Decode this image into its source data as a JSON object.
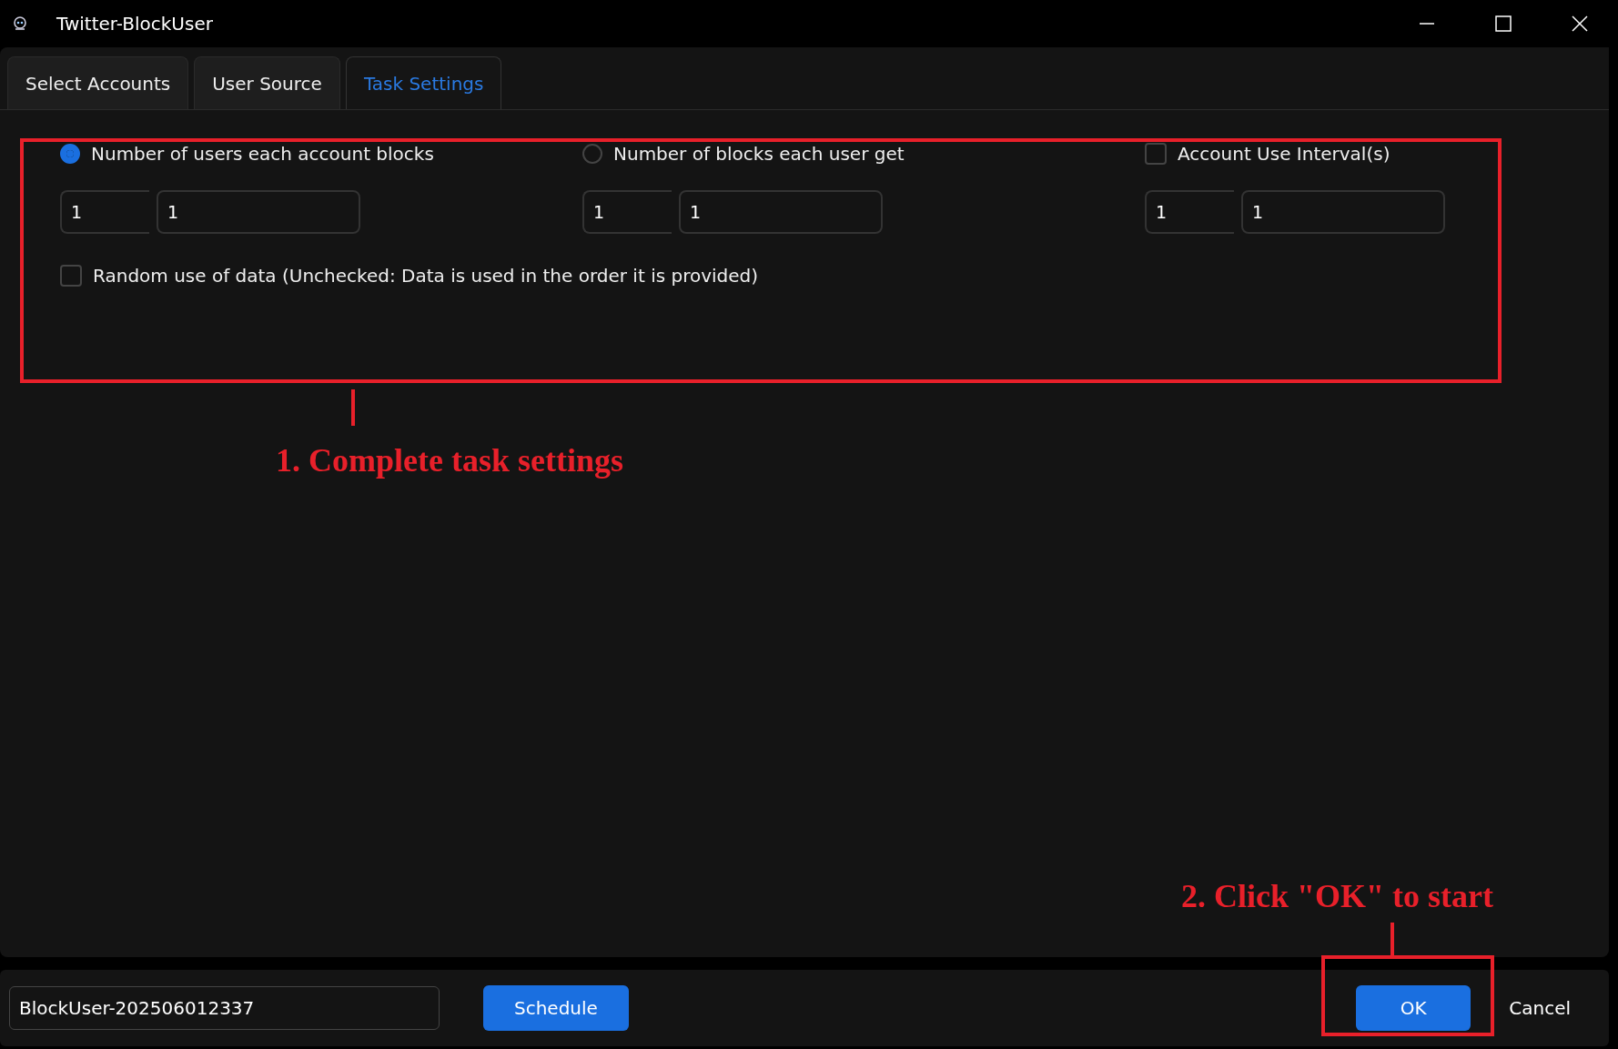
{
  "window": {
    "title": "Twitter-BlockUser"
  },
  "tabs": [
    {
      "label": "Select Accounts",
      "selected": false
    },
    {
      "label": "User Source",
      "selected": false
    },
    {
      "label": "Task Settings",
      "selected": true
    }
  ],
  "options": [
    {
      "kind": "radio",
      "label": "Number of users each account blocks",
      "checked": true,
      "fields": [
        "1",
        "1"
      ]
    },
    {
      "kind": "radio",
      "label": "Number of blocks each user get",
      "checked": false,
      "fields": [
        "1",
        "1"
      ]
    },
    {
      "kind": "checkbox",
      "label": "Account Use Interval(s)",
      "checked": false,
      "fields": [
        "1",
        "1"
      ]
    }
  ],
  "random_option": {
    "label": "Random use of data (Unchecked: Data is used in the order it is provided)",
    "checked": false
  },
  "footer": {
    "task_name": "BlockUser-202506012337",
    "schedule_button": "Schedule",
    "ok_button": "OK",
    "cancel_button": "Cancel"
  },
  "annotations": [
    "1. Complete task settings",
    "2. Click \"OK\" to start"
  ]
}
